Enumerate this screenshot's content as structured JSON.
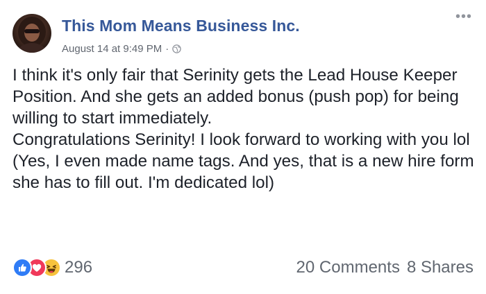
{
  "post": {
    "author": "This Mom Means Business Inc.",
    "date": "August 14 at 9:49 PM",
    "separator": "·",
    "privacy_icon": "globe-icon",
    "more_icon": "more-options-icon",
    "body_paragraphs": [
      "I think it's only fair that Serinity gets the Lead House Keeper Position. And she gets an added bonus (push pop) for being willing to start immediately.",
      "Congratulations Serinity! I look forward to working with you lol",
      "(Yes, I even made name tags. And yes, that is a new hire form she has to fill out. I'm dedicated lol)"
    ]
  },
  "footer": {
    "reaction_icons": [
      "like-icon",
      "love-icon",
      "haha-icon"
    ],
    "reaction_count": "296",
    "comments": "20 Comments",
    "shares": "8 Shares"
  },
  "colors": {
    "author_link": "#365899",
    "meta_text": "#616770",
    "body_text": "#1d2129",
    "like": "#2f7cf6",
    "love": "#f0395a",
    "haha": "#f7c33d"
  }
}
